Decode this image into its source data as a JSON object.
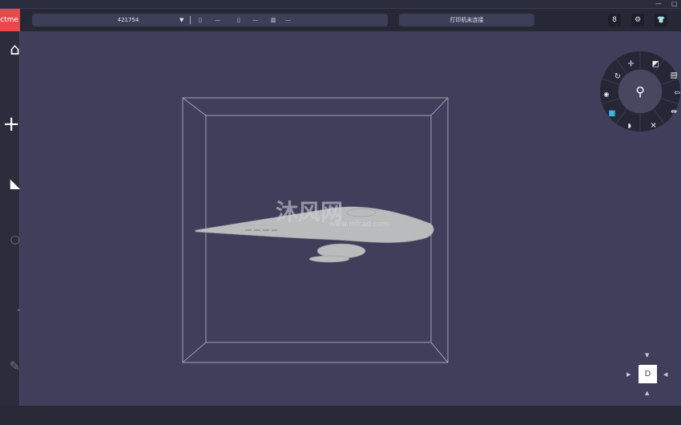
{
  "window": {
    "minimize": "—",
    "restore": "▢"
  },
  "toolbar": {
    "logo": "ctme",
    "printer_name": "421754",
    "dropdown_arrow": "▼",
    "stats": [
      {
        "icon": "nozzle1-icon",
        "value": "—"
      },
      {
        "icon": "nozzle2-icon",
        "value": "—"
      },
      {
        "icon": "bed-icon",
        "value": "—"
      }
    ],
    "connection_status": "打印机未连接",
    "buttons": [
      {
        "icon": "account-icon",
        "glyph": "8"
      },
      {
        "icon": "settings-icon",
        "glyph": "⚙"
      },
      {
        "icon": "shirt-icon",
        "glyph": "👕"
      }
    ]
  },
  "sidebar": {
    "items": [
      {
        "icon": "home-icon",
        "glyph": "⌂"
      },
      {
        "icon": "add-icon",
        "glyph": "+"
      },
      {
        "icon": "edit-icon",
        "glyph": "◣"
      },
      {
        "icon": "search-icon",
        "glyph": "○"
      },
      {
        "icon": "ruler-icon",
        "glyph": "▪"
      },
      {
        "icon": "tools-icon",
        "glyph": "✎"
      }
    ]
  },
  "radial_menu": {
    "center_icon": "support-paint-icon",
    "items": [
      "move-icon",
      "scale-icon",
      "layers-icon",
      "undo-icon",
      "mirror-icon",
      "fit-icon",
      "paint-icon",
      "cube-icon",
      "eye-icon",
      "rotate-icon"
    ],
    "accent": "#3ab4e8"
  },
  "view_cube": {
    "face": "D",
    "arrows": [
      "▼",
      "▶",
      "◀",
      "▲"
    ]
  },
  "watermark": {
    "title": "沐风网",
    "url": "www.mfcad.com"
  },
  "colors": {
    "viewport": "#3f3f5b",
    "logo": "#e8494c"
  }
}
